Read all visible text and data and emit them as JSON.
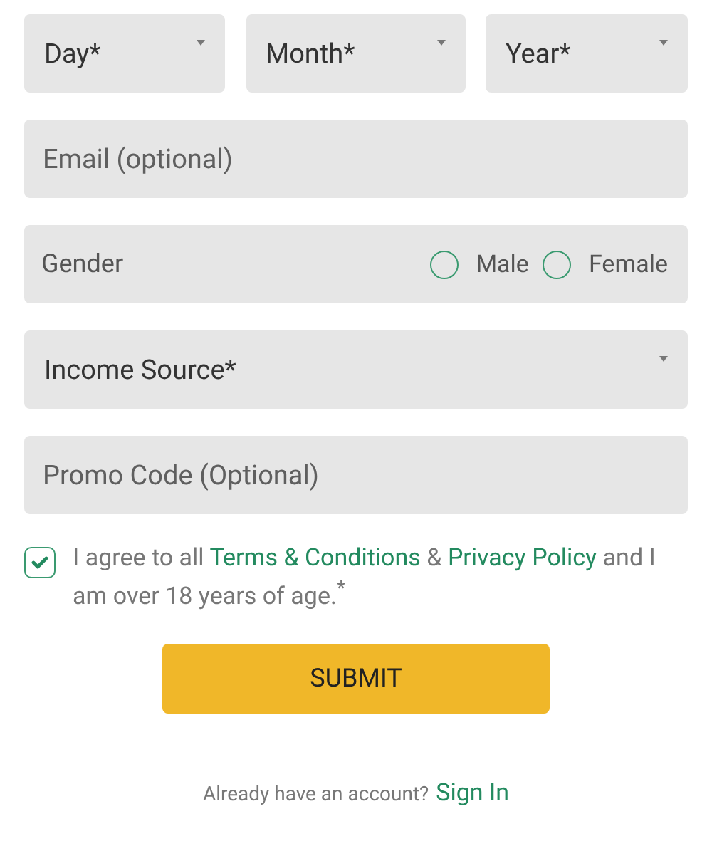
{
  "date_selects": [
    {
      "label": "Day*"
    },
    {
      "label": "Month*"
    },
    {
      "label": "Year*"
    }
  ],
  "email": {
    "placeholder": "Email (optional)"
  },
  "gender": {
    "label": "Gender",
    "options": [
      {
        "label": "Male",
        "selected": false
      },
      {
        "label": "Female",
        "selected": false
      }
    ]
  },
  "income_source": {
    "label": "Income Source*"
  },
  "promo": {
    "placeholder": "Promo Code (Optional)"
  },
  "agreement": {
    "checked": true,
    "parts": [
      {
        "kind": "text",
        "text": "I agree to all "
      },
      {
        "kind": "link",
        "text": "Terms & Conditions"
      },
      {
        "kind": "text",
        "text": " & "
      },
      {
        "kind": "link",
        "text": "Privacy Policy"
      },
      {
        "kind": "text",
        "text": " and I am over 18 years of age.$^{*}$"
      }
    ]
  },
  "submit": "SUBMIT",
  "signin": {
    "prompt": "Already have an account?",
    "link": "Sign In"
  }
}
